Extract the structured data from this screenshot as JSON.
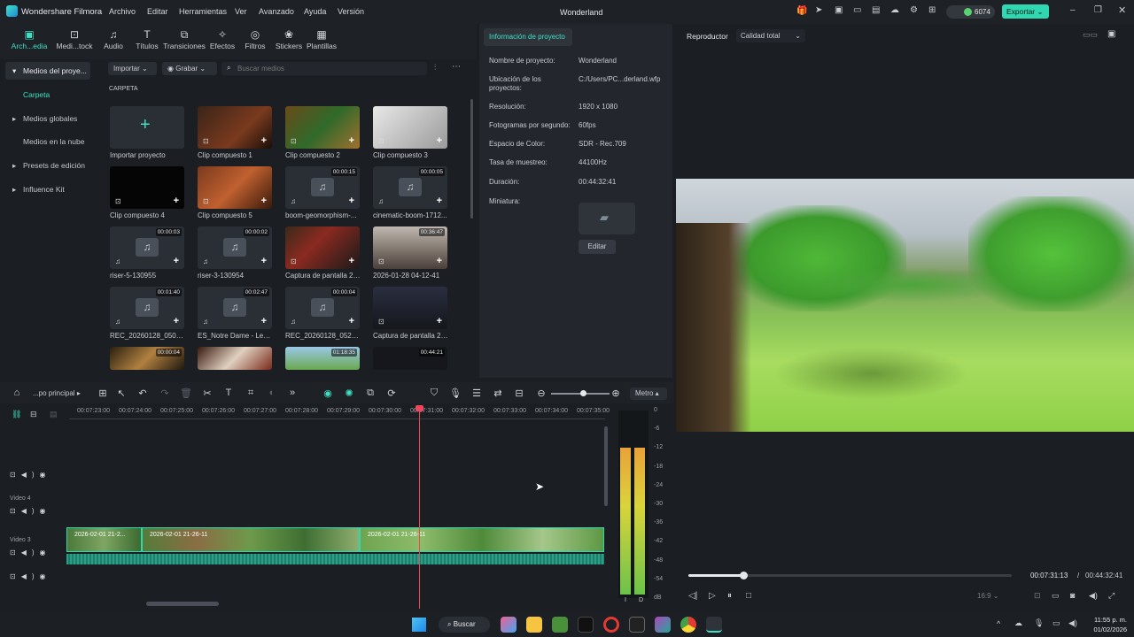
{
  "app": {
    "name": "Wondershare Filmora",
    "project_title": "Wonderland",
    "credits": "6074",
    "export_label": "Exportar"
  },
  "menu": [
    "Archivo",
    "Editar",
    "Herramientas",
    "Ver",
    "Avanzado",
    "Ayuda",
    "Versión"
  ],
  "toolbar": [
    "Arch...edia",
    "Medi...tock",
    "Audio",
    "Títulos",
    "Transiciones",
    "Efectos",
    "Filtros",
    "Stickers",
    "Plantillas"
  ],
  "sidebar": {
    "items": [
      "Medios del proye...",
      "Carpeta",
      "Medios globales",
      "Medios en la nube",
      "Presets de edición",
      "Influence Kit"
    ]
  },
  "media": {
    "import_label": "Importar",
    "record_label": "Grabar",
    "search_placeholder": "Buscar medios",
    "folder_label": "CARPETA",
    "items": [
      {
        "caption": "Importar proyecto",
        "duration": ""
      },
      {
        "caption": "Clip compuesto 1",
        "duration": ""
      },
      {
        "caption": "Clip compuesto 2",
        "duration": ""
      },
      {
        "caption": "Clip compuesto 3",
        "duration": ""
      },
      {
        "caption": "Clip compuesto 4",
        "duration": ""
      },
      {
        "caption": "Clip compuesto 5",
        "duration": ""
      },
      {
        "caption": "boom-geomorphism-...",
        "duration": "00:00:15"
      },
      {
        "caption": "cinematic-boom-1712...",
        "duration": "00:00:05"
      },
      {
        "caption": "riser-5-130955",
        "duration": "00:00:03"
      },
      {
        "caption": "riser-3-130954",
        "duration": "00:00:02"
      },
      {
        "caption": "Captura de pantalla 20...",
        "duration": ""
      },
      {
        "caption": "2026-01-28 04-12-41",
        "duration": "00:36:47"
      },
      {
        "caption": "REC_20260128_050657",
        "duration": "00:01:40"
      },
      {
        "caption": "ES_Notre Dame - Lenn...",
        "duration": "00:02:47"
      },
      {
        "caption": "REC_20260128_052727",
        "duration": "00:00:04"
      },
      {
        "caption": "Captura de pantalla 20...",
        "duration": ""
      },
      {
        "caption": "",
        "duration": "00:00:04"
      },
      {
        "caption": "",
        "duration": ""
      },
      {
        "caption": "",
        "duration": "01:18:35"
      },
      {
        "caption": "",
        "duration": "00:44:21"
      }
    ]
  },
  "info": {
    "tab_label": "Información de proyecto",
    "rows": [
      {
        "label": "Nombre de proyecto:",
        "value": "Wonderland"
      },
      {
        "label": "Ubicación de los proyectos:",
        "value": "C:/Users/PC...derland.wfp"
      },
      {
        "label": "Resolución:",
        "value": "1920 x 1080"
      },
      {
        "label": "Fotogramas por segundo:",
        "value": "60fps"
      },
      {
        "label": "Espacio de Color:",
        "value": "SDR - Rec.709"
      },
      {
        "label": "Tasa de muestreo:",
        "value": "44100Hz"
      },
      {
        "label": "Duración:",
        "value": "00:44:32:41"
      },
      {
        "label": "Miniatura:",
        "value": ""
      }
    ],
    "edit_label": "Editar"
  },
  "player": {
    "label": "Reproductor",
    "quality": "Calidad total",
    "current_time": "00:07:31:13",
    "total_time": "00:44:32:41",
    "ratio": "16:9",
    "progress": 0.17
  },
  "timeline": {
    "sequence_label": "...po principal",
    "meter_label": "Metro",
    "ticks": [
      "00:07:23:00",
      "00:07:24:00",
      "00:07:25:00",
      "00:07:26:00",
      "00:07:27:00",
      "00:07:28:00",
      "00:07:29:00",
      "00:07:30:00",
      "00:07:31:00",
      "00:07:32:00",
      "00:07:33:00",
      "00:07:34:00",
      "00:07:35:00"
    ],
    "tracks": [
      "Video 4",
      "Video 3"
    ],
    "clips": [
      "2026-02-01 21-2...",
      "2026-02-01 21-26-11",
      "2026-02-01 21-26-11"
    ],
    "db_scale": [
      "0",
      "-6",
      "-12",
      "-18",
      "-24",
      "-30",
      "-36",
      "-42",
      "-48",
      "-54",
      "dB"
    ],
    "meter_channels": [
      "I",
      "D"
    ]
  },
  "taskbar": {
    "search_label": "Buscar",
    "time": "11:55 p. m.",
    "date": "01/02/2026"
  }
}
